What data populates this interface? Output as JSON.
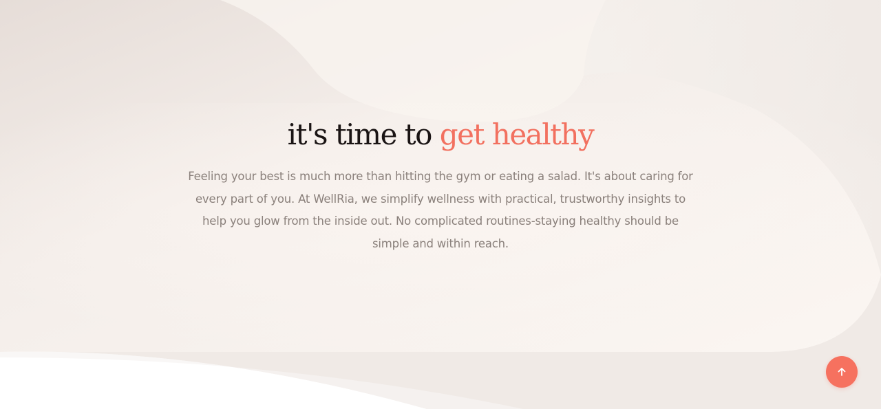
{
  "hero": {
    "heading_main": "it's time to ",
    "heading_accent": "get healthy",
    "body": "Feeling your best is much more than hitting the gym or eating a salad. It's about caring for every part of you. At WellRia, we simplify wellness with practical, trustworthy insights to help you glow from the inside out. No complicated routines-staying healthy should be simple and within reach."
  },
  "scroll_top": {
    "icon": "arrow-up-icon"
  },
  "colors": {
    "accent": "#f6715f",
    "heading": "#1a1414",
    "body_text": "#8a807b",
    "background": "#f7f1ed"
  }
}
